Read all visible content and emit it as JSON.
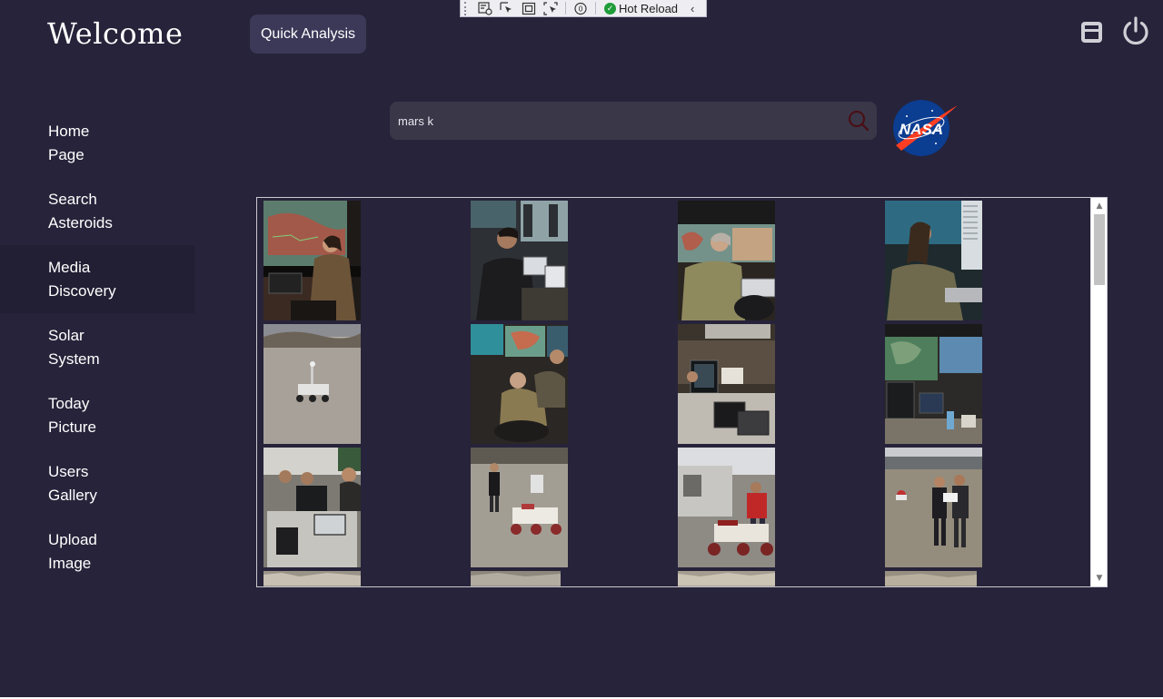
{
  "header": {
    "title": "Welcome",
    "quick_analysis_label": "Quick Analysis"
  },
  "debug_toolbar": {
    "hot_reload_label": "Hot Reload"
  },
  "window_controls": [
    "restore-icon",
    "power-icon"
  ],
  "nav": {
    "items": [
      {
        "label": "Home\nPage",
        "active": false
      },
      {
        "label": "Search\nAsteroids",
        "active": false
      },
      {
        "label": "Media\nDiscovery",
        "active": true
      },
      {
        "label": "Solar\nSystem",
        "active": false
      },
      {
        "label": "Today\nPicture",
        "active": false
      },
      {
        "label": "Users\nGallery",
        "active": false
      },
      {
        "label": "Upload\nImage",
        "active": false
      }
    ]
  },
  "search": {
    "value": "mars k",
    "icon": "search-icon"
  },
  "logo": {
    "text": "NASA",
    "color": "#0b3d91",
    "accent": "#fc3d21"
  },
  "colors": {
    "background": "#27233a",
    "sidebar_active": "#221e33",
    "button": "#3b3858",
    "search_bg": "#3a3748"
  },
  "gallery": {
    "rows": [
      [
        "mission-control-operator",
        "operator-with-headset",
        "scientist-at-console",
        "operator-long-hair"
      ],
      [
        "rover-in-desert",
        "team-at-monitors",
        "control-room-laptops",
        "workstation-monitors"
      ],
      [
        "field-tent-laptops",
        "person-walking-with-rover",
        "rover-near-trailer",
        "two-people-reviewing-papers"
      ],
      [
        "rocky-ground",
        "rocky-ground",
        "rocky-ground",
        "rocky-ground"
      ]
    ]
  }
}
